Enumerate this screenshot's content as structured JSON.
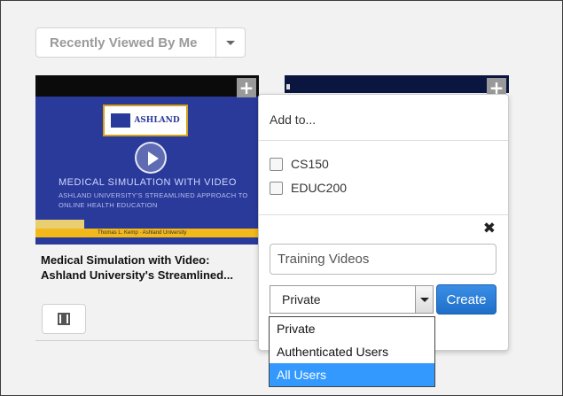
{
  "filter": {
    "label": "Recently Viewed By Me"
  },
  "card1": {
    "title": "Medical Simulation with Video: Ashland University's Streamlined...",
    "thumbnail": {
      "logo_text": "ASHLAND",
      "slide_title": "MEDICAL SIMULATION WITH VIDEO",
      "slide_subtitle": "ASHLAND UNIVERSITY'S STREAMLINED APPROACH TO ONLINE HEALTH EDUCATION",
      "presenter": "Thomas L. Kemp · Ashland University"
    }
  },
  "popover": {
    "header": "Add to...",
    "playlists": [
      {
        "label": "CS150",
        "checked": false
      },
      {
        "label": "EDUC200",
        "checked": false
      }
    ],
    "new_name_value": "Training Videos",
    "visibility_selected": "Private",
    "create_label": "Create"
  },
  "visibility_options": [
    {
      "label": "Private",
      "selected": false
    },
    {
      "label": "Authenticated Users",
      "selected": false
    },
    {
      "label": "All Users",
      "selected": true
    }
  ],
  "icons": {
    "plus": "+",
    "close": "✖"
  },
  "colors": {
    "accent": "#3399ff",
    "create_button": "#2a7fd6",
    "slide_blue": "#2a3a9a",
    "slide_gold": "#f3b81a"
  }
}
